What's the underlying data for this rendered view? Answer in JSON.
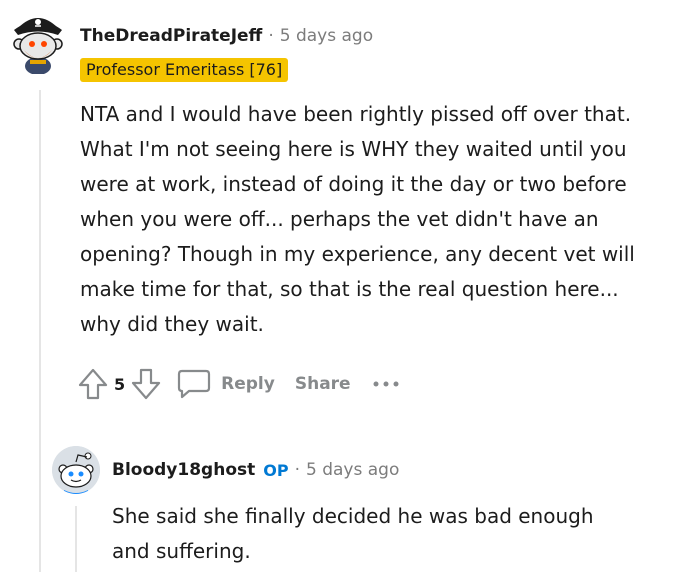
{
  "comment": {
    "username": "TheDreadPirateJeff",
    "separator": "·",
    "timestamp": "5 days ago",
    "flair": "Professor Emeritass [76]",
    "body_lines": [
      "NTA and I would have been rightly pissed off over that.",
      "What I'm not seeing here is WHY they waited until you",
      "were at work, instead of doing it the day or two before",
      "when you were off... perhaps the vet didn't have an",
      "opening? Though in my experience, any decent vet will",
      "make time for that, so that is the real question here...",
      "why did they wait."
    ],
    "vote_count": "5",
    "reply_label": "Reply",
    "share_label": "Share",
    "more_icon": "ellipsis-icon",
    "upvote_icon": "upvote-arrow-icon",
    "downvote_icon": "downvote-arrow-icon",
    "reply_icon": "speech-bubble-icon"
  },
  "reply": {
    "username": "Bloody18ghost",
    "op_badge": "OP",
    "separator": "·",
    "timestamp": "5 days ago",
    "body_lines": [
      "She said she finally decided he was bad enough",
      "and suffering."
    ]
  },
  "colors": {
    "flair_bg": "#f5c400",
    "op_badge": "#0079d3",
    "muted": "#7c7c7c",
    "action": "#878a8c",
    "thread_line": "#e5e5e5"
  }
}
